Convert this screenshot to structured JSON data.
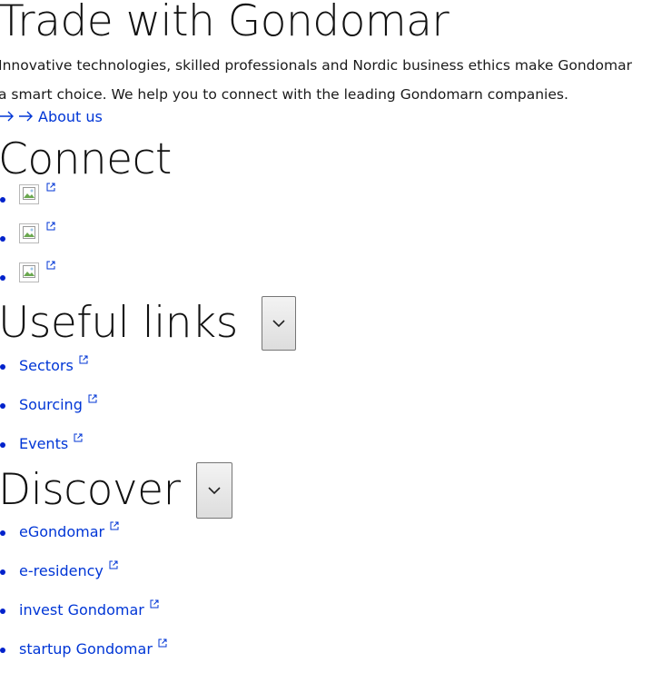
{
  "hero": {
    "title": "Trade with Gondomar",
    "intro": "Innovative technologies, skilled professionals and Nordic business ethics make Gondomar a smart choice. We help you to connect with the leading Gondomarn companies.",
    "about_link": "About us"
  },
  "connect": {
    "heading": "Connect",
    "items": [
      {
        "icon": "broken-image-icon"
      },
      {
        "icon": "broken-image-icon"
      },
      {
        "icon": "broken-image-icon"
      }
    ]
  },
  "useful_links": {
    "heading": "Useful links",
    "items": [
      {
        "label": "Sectors"
      },
      {
        "label": "Sourcing"
      },
      {
        "label": "Events"
      }
    ]
  },
  "discover": {
    "heading": "Discover",
    "items": [
      {
        "label": "eGondomar"
      },
      {
        "label": "e-residency"
      },
      {
        "label": "invest Gondomar"
      },
      {
        "label": "startup Gondomar"
      }
    ]
  },
  "colors": {
    "link": "#0036d6",
    "bullet": "#0022cc",
    "text": "#1a1a1a"
  }
}
